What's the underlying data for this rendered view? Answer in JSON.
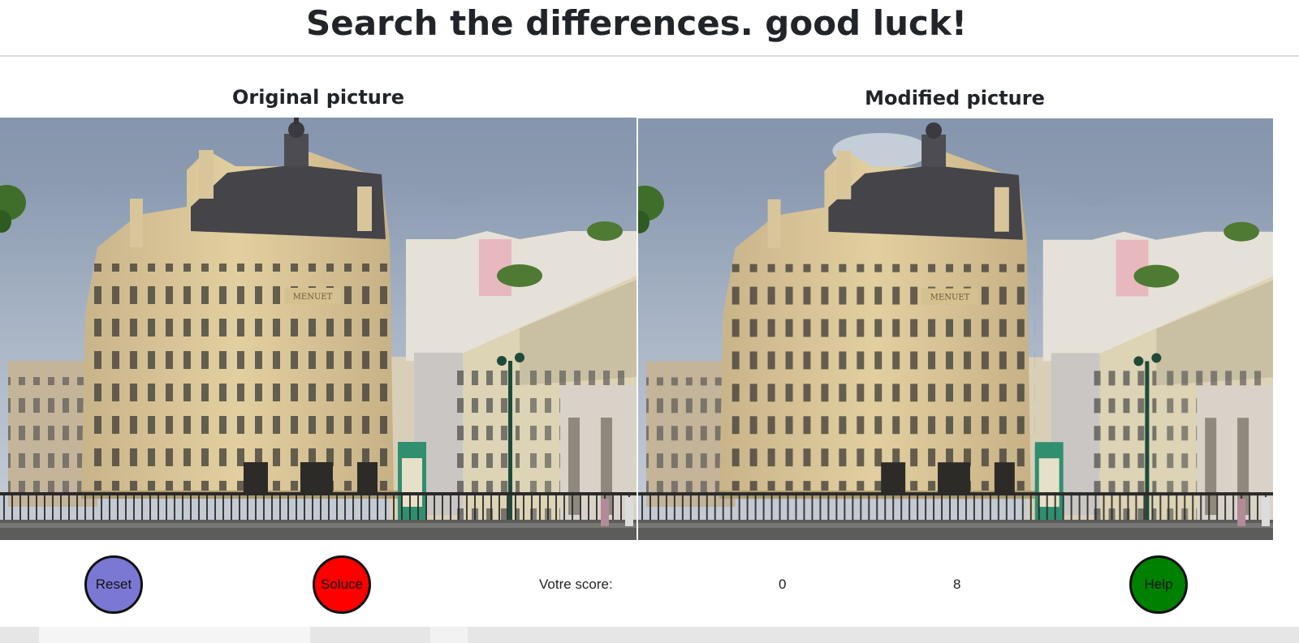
{
  "header": {
    "title": "Search the differences. good luck!"
  },
  "panels": {
    "original_heading": "Original picture",
    "modified_heading": "Modified picture"
  },
  "scene": {
    "description_icon": "street-building-photo",
    "sign_text": "MENUET"
  },
  "controls": {
    "reset_label": "Reset",
    "soluce_label": "Soluce",
    "help_label": "Help",
    "score_label": "Votre score:",
    "score_value": "0",
    "score_total": "8"
  },
  "colors": {
    "reset": "#7b78d4",
    "soluce": "#ff0000",
    "help": "#008000"
  }
}
